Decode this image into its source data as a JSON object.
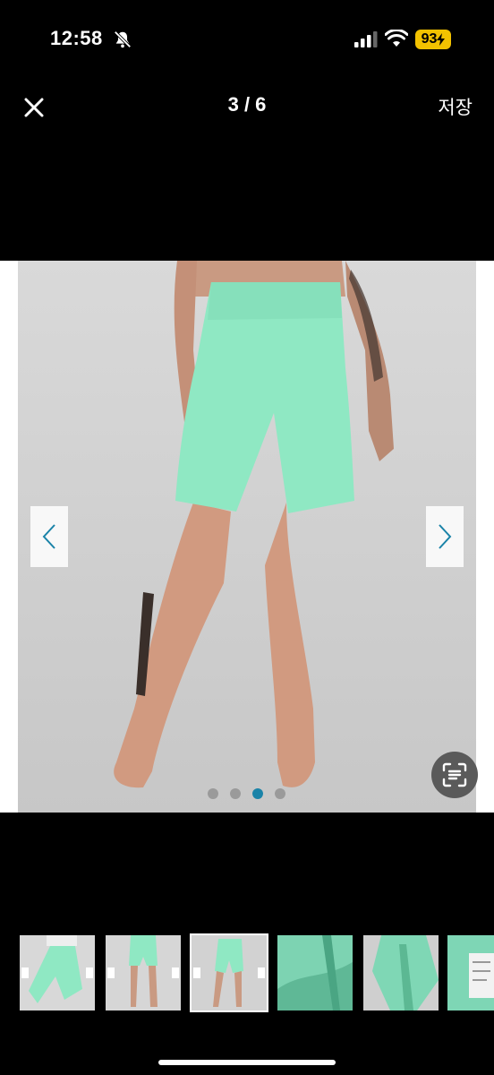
{
  "status_bar": {
    "time": "12:58",
    "battery": "93"
  },
  "header": {
    "page_counter": "3 / 6",
    "save_label": "저장"
  },
  "gallery": {
    "dot_count": 4,
    "active_dot_index": 2,
    "shorts_color": "#8fe8c3",
    "accent_color": "#1a83a8"
  },
  "thumbnails": {
    "count": 6,
    "selected_index": 2
  }
}
